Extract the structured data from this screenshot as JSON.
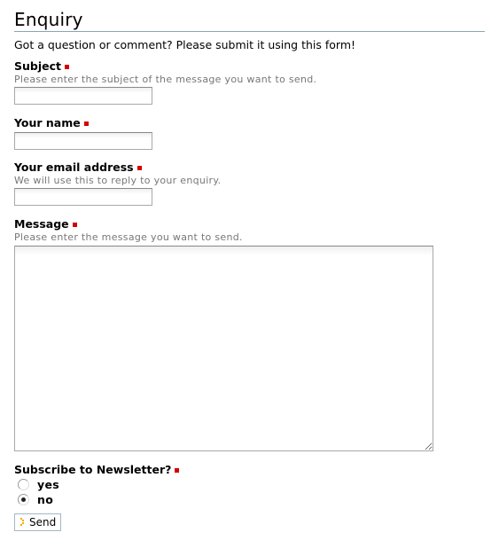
{
  "form": {
    "title": "Enquiry",
    "intro": "Got a question or comment? Please submit it using this form!",
    "fields": {
      "subject": {
        "label": "Subject",
        "help": "Please enter the subject of the message you want to send.",
        "value": ""
      },
      "name": {
        "label": "Your name",
        "value": ""
      },
      "email": {
        "label": "Your email address",
        "help": "We will use this to reply to your enquiry.",
        "value": ""
      },
      "message": {
        "label": "Message",
        "help": "Please enter the message you want to send.",
        "value": ""
      },
      "newsletter": {
        "label": "Subscribe to Newsletter?",
        "options": [
          "yes",
          "no"
        ],
        "selected": "no"
      }
    },
    "send_label": "Send"
  },
  "colors": {
    "required_marker": "#d40000",
    "title_underline": "#8aa4b4",
    "help_text": "#777777",
    "send_icon": "#f5a800"
  }
}
